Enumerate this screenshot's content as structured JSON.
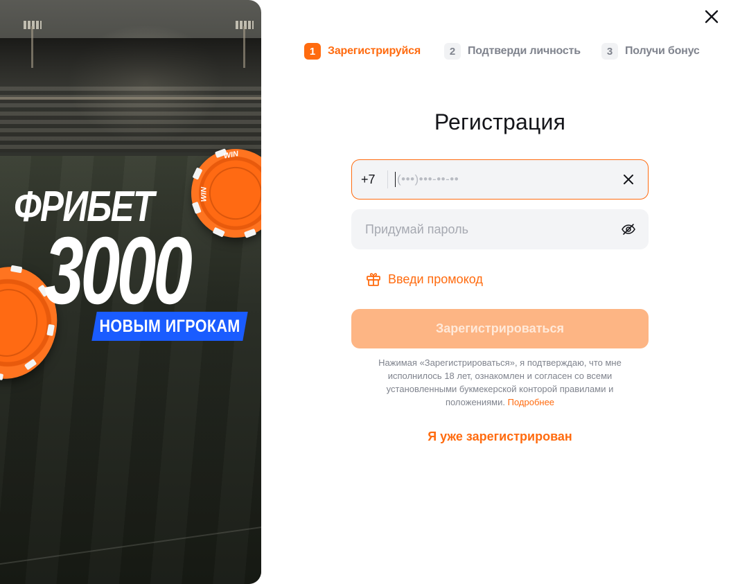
{
  "promo": {
    "title": "ФРИБЕТ",
    "amount": "3000",
    "badge": "НОВЫМ ИГРОКАМ",
    "chip_text": "WIN"
  },
  "close": {
    "icon": "close-icon"
  },
  "steps": [
    {
      "number": "1",
      "label": "Зарегистрируйся",
      "state": "active"
    },
    {
      "number": "2",
      "label": "Подтверди личность",
      "state": "inactive"
    },
    {
      "number": "3",
      "label": "Получи бонус",
      "state": "inactive"
    }
  ],
  "form": {
    "title": "Регистрация",
    "phone": {
      "prefix": "+7",
      "value": "",
      "placeholder": "(•••)•••-••-••",
      "clear_icon": "clear-icon"
    },
    "password": {
      "value": "",
      "placeholder": "Придумай пароль",
      "toggle_icon": "eye-off-icon"
    },
    "promocode": {
      "label": "Введи промокод",
      "icon": "gift-icon"
    },
    "submit_label": "Зарегистрироваться",
    "terms": {
      "text": "Нажимая «Зарегистрироваться», я подтверждаю, что мне исполнилось 18 лет, ознакомлен и согласен со всеми установленными букмекерской конторой правилами и положениями.",
      "link": "Подробнее"
    },
    "login_label": "Я уже зарегистрирован"
  },
  "colors": {
    "accent": "#ff6b0f",
    "accent_disabled": "#fdb584",
    "field_bg": "#f3f4f6",
    "muted_text": "#7f838d",
    "badge_blue": "#1a5cff"
  }
}
